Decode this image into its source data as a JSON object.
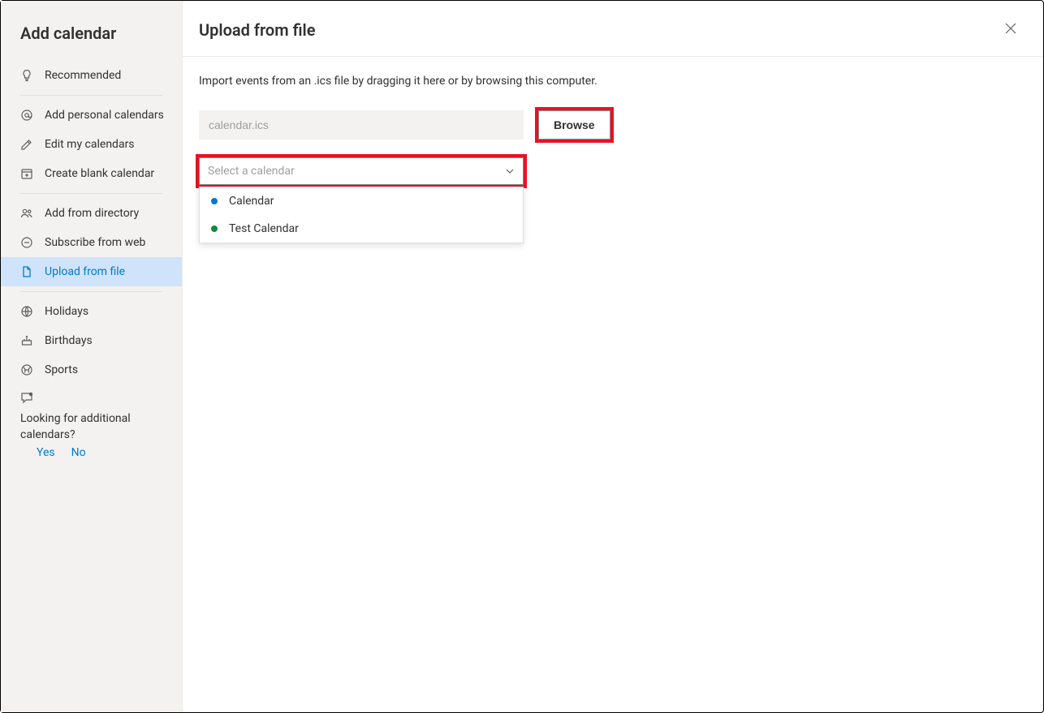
{
  "sidebar": {
    "title": "Add calendar",
    "items": {
      "recommended": "Recommended",
      "add_personal": "Add personal calendars",
      "edit_my": "Edit my calendars",
      "create_blank": "Create blank calendar",
      "add_directory": "Add from directory",
      "subscribe_web": "Subscribe from web",
      "upload_file": "Upload from file",
      "holidays": "Holidays",
      "birthdays": "Birthdays",
      "sports": "Sports"
    },
    "feedback": {
      "text": "Looking for additional calendars?",
      "yes": "Yes",
      "no": "No"
    }
  },
  "main": {
    "title": "Upload from file",
    "description": "Import events from an .ics file by dragging it here or by browsing this computer.",
    "file_placeholder": "calendar.ics",
    "browse_label": "Browse",
    "select_placeholder": "Select a calendar",
    "options": {
      "calendar": "Calendar",
      "test_calendar": "Test Calendar"
    }
  }
}
